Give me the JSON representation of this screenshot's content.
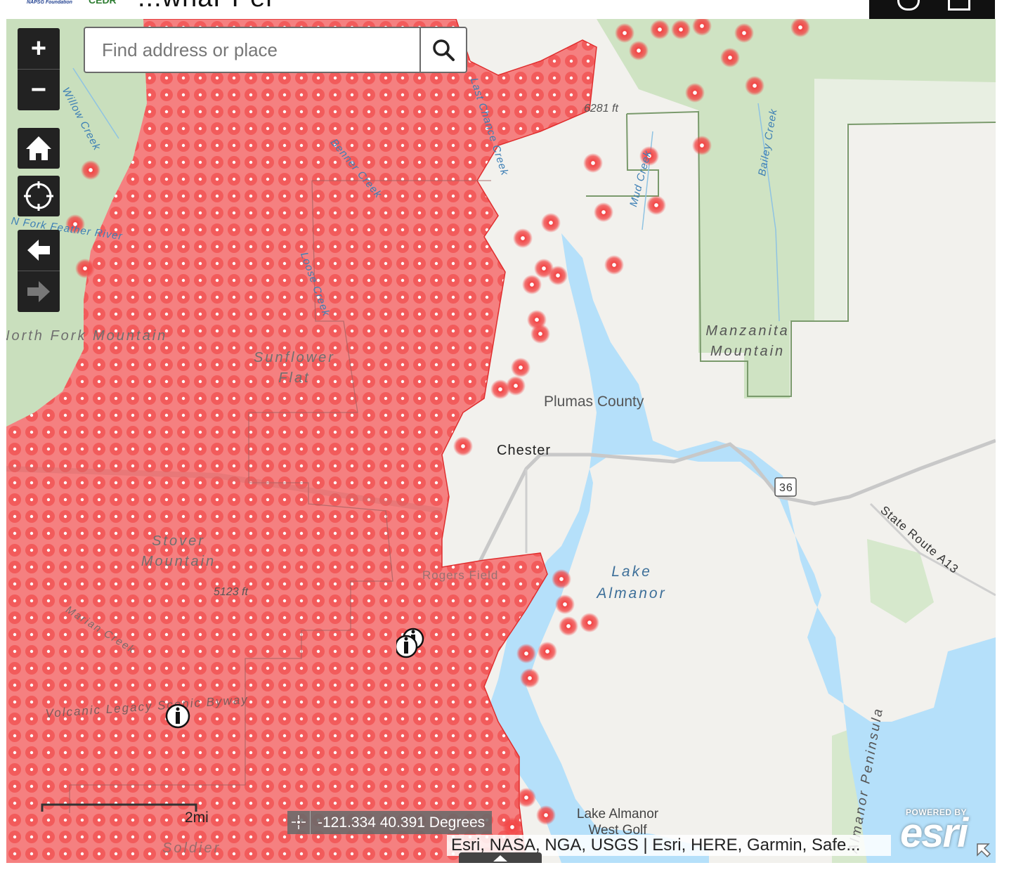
{
  "header": {
    "logo_a": "NAPSG Foundation",
    "logo_b": "CEDR",
    "title_fragment": "...wnaPPer"
  },
  "search": {
    "placeholder": "Find address or place"
  },
  "controls": {
    "zoom_in": "+",
    "zoom_out": "−"
  },
  "map_labels": {
    "willow_creek": "Willow Creek",
    "benner_creek": "Benner Creek",
    "lost_creek": "Last Chance Creek",
    "loose_creek": "Loose Creek",
    "feather_river": "N Fork Feather River",
    "north_fork_mountain": "North Fork Mountain",
    "sunflower_flat": "Sunflower Flat",
    "stover_mountain": "Stover Mountain",
    "elev_5123": "5123 ft",
    "elev_6281": "6281 ft",
    "marian_creek": "Marian Creek",
    "volcanic_byway": "Volcanic Legacy Scenic Byway",
    "soldier": "Soldier",
    "mud_creek": "Mud Creek",
    "bailey_creek": "Bailey Creek",
    "manzanita": "Manzanita Mountain",
    "plumas_county": "Plumas County",
    "chester": "Chester",
    "rogers_field": "Rogers Field",
    "route_36": "36",
    "state_route_a13": "State Route A13",
    "lake_almanor": "Lake Almanor",
    "almanor_peninsula": "Almanor Peninsula",
    "golf": "Lake Almanor West Golf"
  },
  "scale": {
    "label": "2mi"
  },
  "coordinates": {
    "text": "-121.334 40.391 Degrees"
  },
  "attribution": {
    "text": "Esri, NASA, NGA, USGS | Esri, HERE, Garmin, Safe..."
  },
  "esri_logo": {
    "powered_by": "POWERED BY",
    "brand": "esri"
  },
  "colors": {
    "fire_perimeter": "#ef4a4a",
    "water": "#b5e0fa",
    "forest": "#cfe3c3",
    "hotspot": "#f24545"
  }
}
